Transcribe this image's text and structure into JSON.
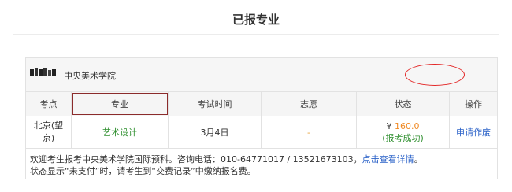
{
  "page": {
    "title": "已报专业"
  },
  "school": {
    "name": "中央美术学院",
    "logo_text": "中央美術學院"
  },
  "table": {
    "headers": [
      "考点",
      "专业",
      "考试时间",
      "志愿",
      "状态",
      "操作"
    ],
    "row": {
      "location": "北京(望京)",
      "major": "艺术设计",
      "exam_date": "3月4日",
      "volunteer": "-",
      "price_symbol": "¥",
      "price": "160.0",
      "status": "(报考成功)",
      "action": "申请作废"
    }
  },
  "notes": {
    "line1_prefix": "欢迎考生报考中央美术学院国际预科。咨询电话：010-64771017 / 13521673103，",
    "line1_link": "点击查看详情",
    "line1_suffix": "。",
    "line2": "状态显示“未支付”时，请考生到“交费记录”中缴纳报名费。"
  },
  "colors": {
    "accent_link": "#2b62c8",
    "success": "#2f8f2f",
    "price": "#f08a24",
    "annotation": "#e32727"
  }
}
